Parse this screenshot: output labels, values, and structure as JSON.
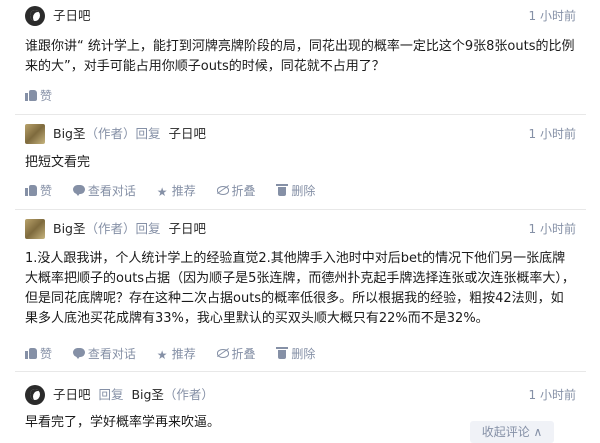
{
  "comments": [
    {
      "username": "子日吧",
      "time": "1 小时前",
      "body": "谁跟你讲“ 统计学上，能打到河牌亮牌阶段的局，同花出现的概率一定比这个9张8张outs的比例来的大”，对手可能占用你顺子outs的时候，同花就不占用了？",
      "like_label": "赞"
    },
    {
      "username": "Big圣",
      "author_tag": "（作者）",
      "reply_word": "回复",
      "reply_to": "子日吧",
      "time": "1 小时前",
      "body": "把短文看完",
      "like_label": "赞",
      "chat_label": "查看对话",
      "recommend_label": "推荐",
      "fold_label": "折叠",
      "delete_label": "删除"
    },
    {
      "username": "Big圣",
      "author_tag": "（作者）",
      "reply_word": "回复",
      "reply_to": "子日吧",
      "time": "1 小时前",
      "body": "1.没人跟我讲，个人统计学上的经验直觉2.其他牌手入池时中对后bet的情况下他们另一张底牌大概率把顺子的outs占据（因为顺子是5张连牌，而德州扑克起手牌选择连张或次连张概率大），但是同花底牌呢？存在这种二次占据outs的概率低很多。所以根据我的经验，粗按42法则，如果多人底池买花成牌有33%，我心里默认的买双头顺大概只有22%而不是32%。",
      "like_label": "赞",
      "chat_label": "查看对话",
      "recommend_label": "推荐",
      "fold_label": "折叠",
      "delete_label": "删除"
    },
    {
      "username": "子日吧",
      "reply_word": "回复",
      "reply_to": "Big圣",
      "author_tag": "（作者）",
      "time": "1 小时前",
      "body": "早看完了，学好概率学再来吹逼。"
    }
  ],
  "collapse_button": "收起评论 ∧"
}
